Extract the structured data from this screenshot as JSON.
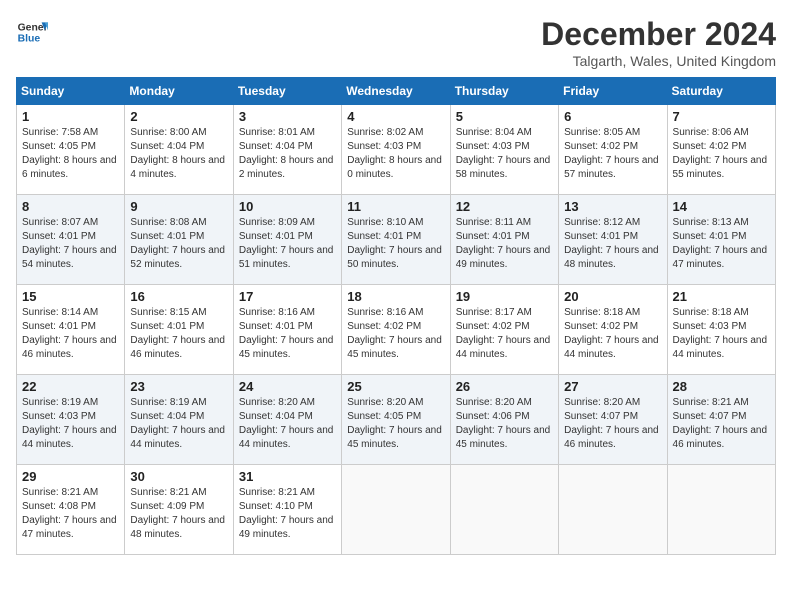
{
  "header": {
    "logo_line1": "General",
    "logo_line2": "Blue",
    "title": "December 2024",
    "location": "Talgarth, Wales, United Kingdom"
  },
  "days_of_week": [
    "Sunday",
    "Monday",
    "Tuesday",
    "Wednesday",
    "Thursday",
    "Friday",
    "Saturday"
  ],
  "weeks": [
    [
      {
        "day": "1",
        "rise": "Sunrise: 7:58 AM",
        "set": "Sunset: 4:05 PM",
        "daylight": "Daylight: 8 hours and 6 minutes."
      },
      {
        "day": "2",
        "rise": "Sunrise: 8:00 AM",
        "set": "Sunset: 4:04 PM",
        "daylight": "Daylight: 8 hours and 4 minutes."
      },
      {
        "day": "3",
        "rise": "Sunrise: 8:01 AM",
        "set": "Sunset: 4:04 PM",
        "daylight": "Daylight: 8 hours and 2 minutes."
      },
      {
        "day": "4",
        "rise": "Sunrise: 8:02 AM",
        "set": "Sunset: 4:03 PM",
        "daylight": "Daylight: 8 hours and 0 minutes."
      },
      {
        "day": "5",
        "rise": "Sunrise: 8:04 AM",
        "set": "Sunset: 4:03 PM",
        "daylight": "Daylight: 7 hours and 58 minutes."
      },
      {
        "day": "6",
        "rise": "Sunrise: 8:05 AM",
        "set": "Sunset: 4:02 PM",
        "daylight": "Daylight: 7 hours and 57 minutes."
      },
      {
        "day": "7",
        "rise": "Sunrise: 8:06 AM",
        "set": "Sunset: 4:02 PM",
        "daylight": "Daylight: 7 hours and 55 minutes."
      }
    ],
    [
      {
        "day": "8",
        "rise": "Sunrise: 8:07 AM",
        "set": "Sunset: 4:01 PM",
        "daylight": "Daylight: 7 hours and 54 minutes."
      },
      {
        "day": "9",
        "rise": "Sunrise: 8:08 AM",
        "set": "Sunset: 4:01 PM",
        "daylight": "Daylight: 7 hours and 52 minutes."
      },
      {
        "day": "10",
        "rise": "Sunrise: 8:09 AM",
        "set": "Sunset: 4:01 PM",
        "daylight": "Daylight: 7 hours and 51 minutes."
      },
      {
        "day": "11",
        "rise": "Sunrise: 8:10 AM",
        "set": "Sunset: 4:01 PM",
        "daylight": "Daylight: 7 hours and 50 minutes."
      },
      {
        "day": "12",
        "rise": "Sunrise: 8:11 AM",
        "set": "Sunset: 4:01 PM",
        "daylight": "Daylight: 7 hours and 49 minutes."
      },
      {
        "day": "13",
        "rise": "Sunrise: 8:12 AM",
        "set": "Sunset: 4:01 PM",
        "daylight": "Daylight: 7 hours and 48 minutes."
      },
      {
        "day": "14",
        "rise": "Sunrise: 8:13 AM",
        "set": "Sunset: 4:01 PM",
        "daylight": "Daylight: 7 hours and 47 minutes."
      }
    ],
    [
      {
        "day": "15",
        "rise": "Sunrise: 8:14 AM",
        "set": "Sunset: 4:01 PM",
        "daylight": "Daylight: 7 hours and 46 minutes."
      },
      {
        "day": "16",
        "rise": "Sunrise: 8:15 AM",
        "set": "Sunset: 4:01 PM",
        "daylight": "Daylight: 7 hours and 46 minutes."
      },
      {
        "day": "17",
        "rise": "Sunrise: 8:16 AM",
        "set": "Sunset: 4:01 PM",
        "daylight": "Daylight: 7 hours and 45 minutes."
      },
      {
        "day": "18",
        "rise": "Sunrise: 8:16 AM",
        "set": "Sunset: 4:02 PM",
        "daylight": "Daylight: 7 hours and 45 minutes."
      },
      {
        "day": "19",
        "rise": "Sunrise: 8:17 AM",
        "set": "Sunset: 4:02 PM",
        "daylight": "Daylight: 7 hours and 44 minutes."
      },
      {
        "day": "20",
        "rise": "Sunrise: 8:18 AM",
        "set": "Sunset: 4:02 PM",
        "daylight": "Daylight: 7 hours and 44 minutes."
      },
      {
        "day": "21",
        "rise": "Sunrise: 8:18 AM",
        "set": "Sunset: 4:03 PM",
        "daylight": "Daylight: 7 hours and 44 minutes."
      }
    ],
    [
      {
        "day": "22",
        "rise": "Sunrise: 8:19 AM",
        "set": "Sunset: 4:03 PM",
        "daylight": "Daylight: 7 hours and 44 minutes."
      },
      {
        "day": "23",
        "rise": "Sunrise: 8:19 AM",
        "set": "Sunset: 4:04 PM",
        "daylight": "Daylight: 7 hours and 44 minutes."
      },
      {
        "day": "24",
        "rise": "Sunrise: 8:20 AM",
        "set": "Sunset: 4:04 PM",
        "daylight": "Daylight: 7 hours and 44 minutes."
      },
      {
        "day": "25",
        "rise": "Sunrise: 8:20 AM",
        "set": "Sunset: 4:05 PM",
        "daylight": "Daylight: 7 hours and 45 minutes."
      },
      {
        "day": "26",
        "rise": "Sunrise: 8:20 AM",
        "set": "Sunset: 4:06 PM",
        "daylight": "Daylight: 7 hours and 45 minutes."
      },
      {
        "day": "27",
        "rise": "Sunrise: 8:20 AM",
        "set": "Sunset: 4:07 PM",
        "daylight": "Daylight: 7 hours and 46 minutes."
      },
      {
        "day": "28",
        "rise": "Sunrise: 8:21 AM",
        "set": "Sunset: 4:07 PM",
        "daylight": "Daylight: 7 hours and 46 minutes."
      }
    ],
    [
      {
        "day": "29",
        "rise": "Sunrise: 8:21 AM",
        "set": "Sunset: 4:08 PM",
        "daylight": "Daylight: 7 hours and 47 minutes."
      },
      {
        "day": "30",
        "rise": "Sunrise: 8:21 AM",
        "set": "Sunset: 4:09 PM",
        "daylight": "Daylight: 7 hours and 48 minutes."
      },
      {
        "day": "31",
        "rise": "Sunrise: 8:21 AM",
        "set": "Sunset: 4:10 PM",
        "daylight": "Daylight: 7 hours and 49 minutes."
      },
      null,
      null,
      null,
      null
    ]
  ]
}
